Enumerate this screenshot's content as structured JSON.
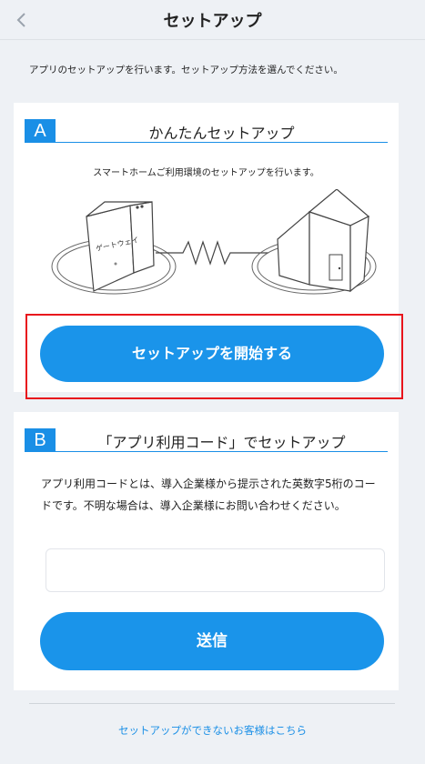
{
  "header": {
    "title": "セットアップ",
    "back_icon": "chevron-left-icon"
  },
  "intro": "アプリのセットアップを行います。セットアップ方法を選んでください。",
  "section_a": {
    "badge": "A",
    "title": "かんたんセットアップ",
    "subtitle": "スマートホームご利用環境のセットアップを行います。",
    "gateway_label": "ゲートウェイ",
    "button_label": "セットアップを開始する"
  },
  "section_b": {
    "badge": "B",
    "title": "「アプリ利用コード」でセットアップ",
    "description": "アプリ利用コードとは、導入企業様から提示された英数字5桁のコードです。不明な場合は、導入企業様にお問い合わせください。",
    "code_value": "",
    "button_label": "送信"
  },
  "footer": {
    "help_link": "セットアップができないお客様はこちら"
  },
  "colors": {
    "accent": "#1a94ea",
    "highlight_border": "#e8141c",
    "background": "#eef1f5"
  }
}
